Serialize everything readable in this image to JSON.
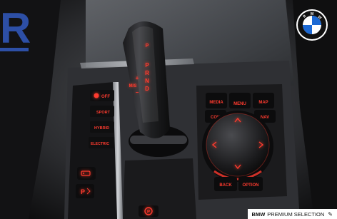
{
  "gear_selector": {
    "position_letters": [
      "P",
      "R",
      "N",
      "D"
    ],
    "manual_label": "M/S",
    "plus": "+",
    "minus": "−",
    "top_indicator": "P"
  },
  "drive_modes": [
    {
      "label": "OFF",
      "icon": "traction-icon"
    },
    {
      "label": "SPORT"
    },
    {
      "label": "HYBRID"
    },
    {
      "label": "ELECTRIC"
    }
  ],
  "idrive": {
    "top_row": [
      "MEDIA",
      "MENU",
      "MAP"
    ],
    "mid_row": [
      "COM",
      "NAV"
    ],
    "bottom_row": [
      "BACK",
      "OPTION"
    ]
  },
  "badge": {
    "brand": "BMW",
    "text": "PREMIUM SELECTION"
  },
  "watermark_letter": "R",
  "colors": {
    "backlight": "#ff3b2f",
    "watermark": "#2d4fa6",
    "bmw_blue": "#1c69d4"
  }
}
